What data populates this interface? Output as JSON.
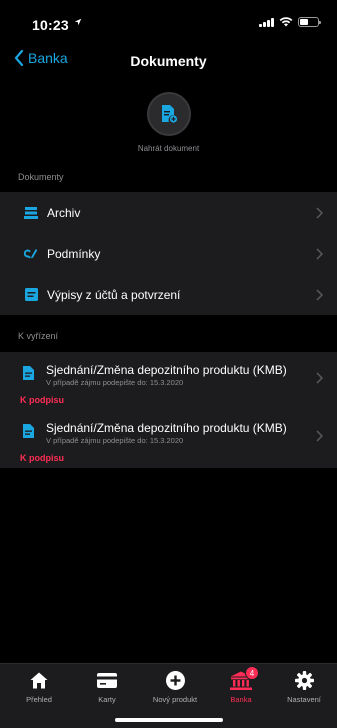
{
  "status": {
    "time": "10:23",
    "location_icon": "location-arrow-icon"
  },
  "nav": {
    "back_label": "Banka",
    "title": "Dokumenty"
  },
  "upload": {
    "label": "Nahrát dokument"
  },
  "documents": {
    "section_label": "Dokumenty",
    "items": [
      {
        "label": "Archiv",
        "icon": "archive-icon"
      },
      {
        "label": "Podmínky",
        "icon": "signature-icon"
      },
      {
        "label": "Výpisy z účtů a potvrzení",
        "icon": "statement-icon"
      }
    ]
  },
  "pending": {
    "section_label": "K vyřízení",
    "items": [
      {
        "title": "Sjednání/Změna depozitního produktu (KMB)",
        "subtitle": "V případě zájmu podepište do: 15.3.2020",
        "badge": "K podpisu"
      },
      {
        "title": "Sjednání/Změna depozitního produktu (KMB)",
        "subtitle": "V případě zájmu podepište do: 15.3.2020",
        "badge": "K podpisu"
      }
    ]
  },
  "tabs": [
    {
      "label": "Přehled",
      "icon": "home-icon"
    },
    {
      "label": "Karty",
      "icon": "card-icon"
    },
    {
      "label": "Nový produkt",
      "icon": "plus-circle-icon"
    },
    {
      "label": "Banka",
      "icon": "bank-icon",
      "badge": "4",
      "active": true
    },
    {
      "label": "Nastavení",
      "icon": "gear-icon"
    }
  ],
  "colors": {
    "accent": "#1aa6e0",
    "active": "#ff2d55",
    "surface": "#1c1c1e",
    "background": "#000000"
  }
}
